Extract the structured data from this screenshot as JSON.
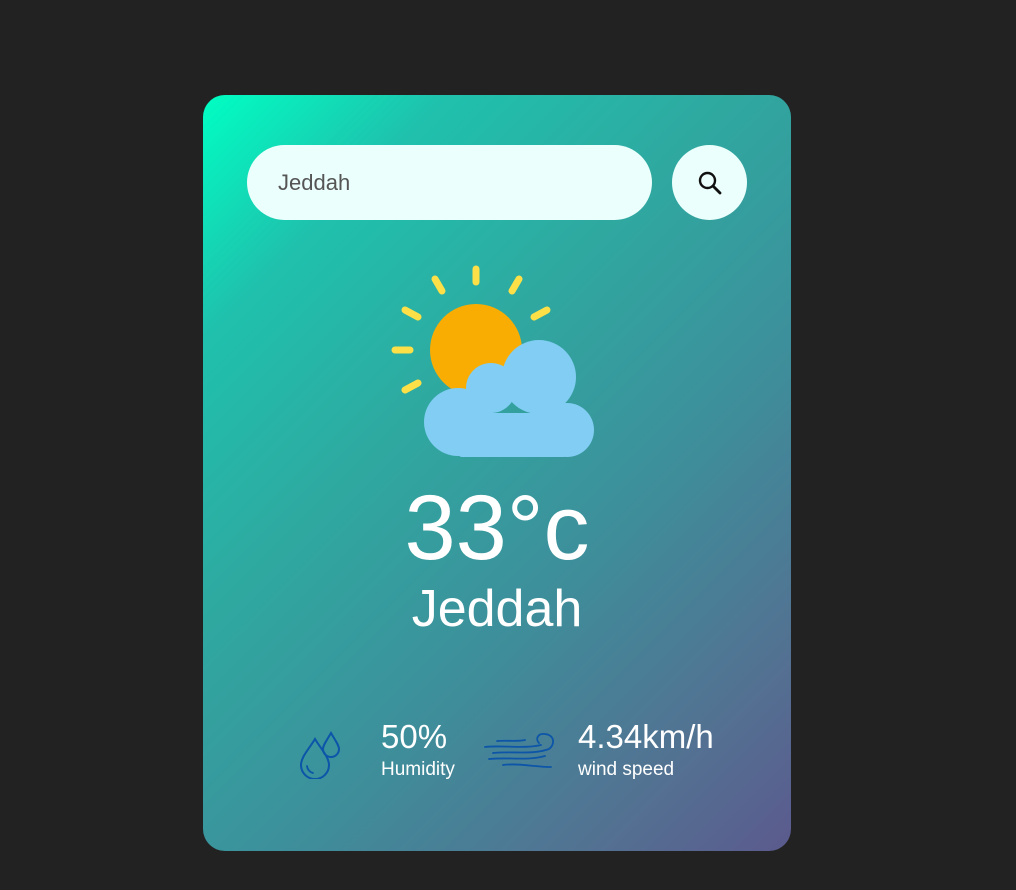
{
  "search": {
    "value": "Jeddah",
    "button_icon": "search-icon"
  },
  "weather": {
    "icon": "partly-cloudy-icon",
    "temperature": "33°c",
    "city": "Jeddah"
  },
  "details": {
    "humidity": {
      "icon": "humidity-icon",
      "value": "50%",
      "label": "Humidity"
    },
    "wind": {
      "icon": "wind-icon",
      "value": "4.34km/h",
      "label": "wind speed"
    }
  },
  "colors": {
    "page_background": "#222222",
    "gradient_start": "#00ffc3",
    "gradient_end": "#5b5a8e",
    "input_background": "#ebfffc",
    "sun": "#f9ad03",
    "sun_rays": "#fde047",
    "cloud": "#82cdf4",
    "detail_icon": "#0c55a8"
  }
}
